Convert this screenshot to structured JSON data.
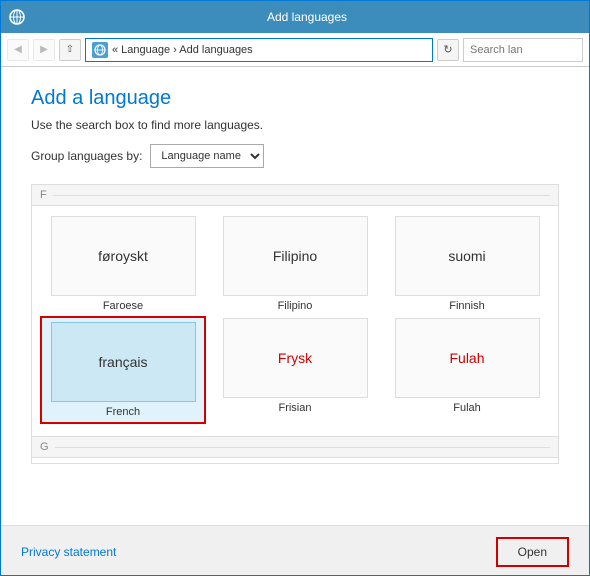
{
  "window": {
    "title": "Add languages",
    "icon": "globe"
  },
  "addressbar": {
    "back_disabled": true,
    "forward_disabled": true,
    "breadcrumb": "« Language › Add languages",
    "search_placeholder": "Search lan"
  },
  "page": {
    "title": "Add a language",
    "subtitle": "Use the search box to find more languages.",
    "group_by_label": "Group languages by:",
    "group_by_value": "Language name"
  },
  "sections": [
    {
      "id": "F",
      "label": "F",
      "languages": [
        {
          "id": "faroese",
          "native": "føroyskt",
          "english": "Faroese",
          "selected": false,
          "stacked": false,
          "colored": false
        },
        {
          "id": "filipino",
          "native": "Filipino",
          "english": "Filipino",
          "selected": false,
          "stacked": false,
          "colored": false
        },
        {
          "id": "finnish",
          "native": "suomi",
          "english": "Finnish",
          "selected": false,
          "stacked": false,
          "colored": false
        },
        {
          "id": "french",
          "native": "français",
          "english": "French",
          "selected": true,
          "stacked": true,
          "colored": false
        },
        {
          "id": "frisian",
          "native": "Frysk",
          "english": "Frisian",
          "selected": false,
          "stacked": false,
          "colored": true
        },
        {
          "id": "fulah",
          "native": "Fulah",
          "english": "Fulah",
          "selected": false,
          "stacked": false,
          "colored": true
        }
      ]
    },
    {
      "id": "G",
      "label": "G",
      "languages": []
    }
  ],
  "footer": {
    "privacy_label": "Privacy statement",
    "open_label": "Open"
  }
}
